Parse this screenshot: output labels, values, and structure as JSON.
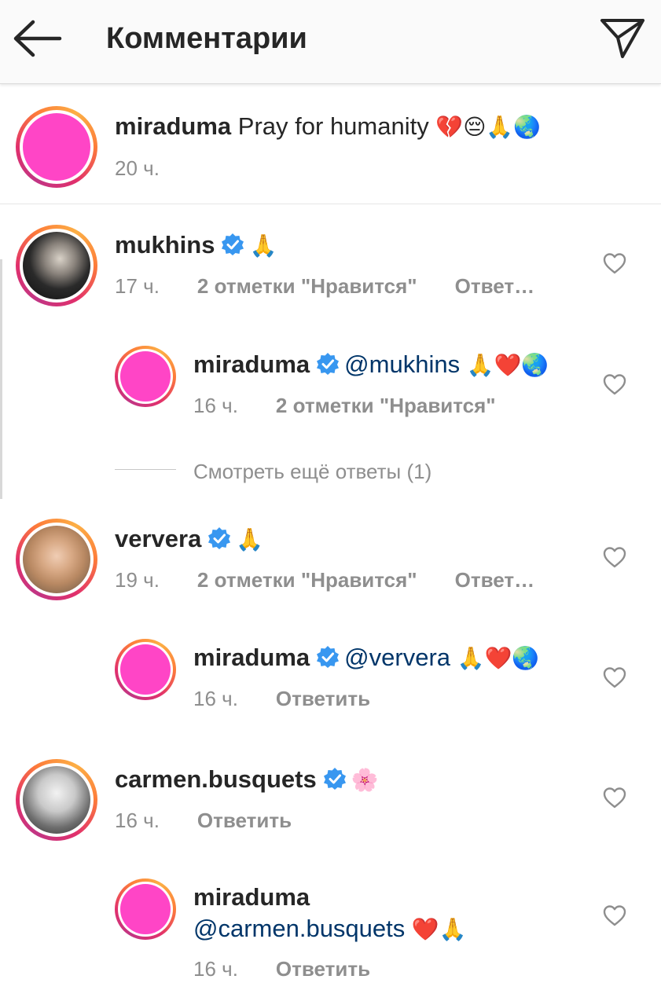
{
  "header": {
    "title": "Комментарии",
    "back_icon": "arrow-left-icon",
    "share_icon": "paper-plane-icon"
  },
  "colors": {
    "avatar_fill": "#ff45c6",
    "mention": "#003569",
    "verified": "#3897f0",
    "muted": "#8e8e8e"
  },
  "caption": {
    "username": "miraduma",
    "text": "Pray for humanity",
    "emoji": "💔😔🙏🌏",
    "time": "20 ч."
  },
  "comments": [
    {
      "username": "mukhins",
      "verified": true,
      "text": "🙏",
      "time": "17 ч.",
      "likes": "2 отметки \"Нравится\"",
      "reply": "Ответ…"
    },
    {
      "username": "miraduma",
      "verified": true,
      "mention": "@mukhins",
      "text": "🙏❤️🌏",
      "time": "16 ч.",
      "likes": "2 отметки \"Нравится\""
    },
    {
      "username": "ververa",
      "verified": true,
      "text": "🙏",
      "time": "19 ч.",
      "likes": "2 отметки \"Нравится\"",
      "reply": "Ответ…"
    },
    {
      "username": "miraduma",
      "verified": true,
      "mention": "@ververa",
      "text": "🙏❤️🌏",
      "time": "16 ч.",
      "reply": "Ответить"
    },
    {
      "username": "carmen.busquets",
      "verified": true,
      "text": "🌸",
      "time": "16 ч.",
      "reply": "Ответить"
    },
    {
      "username": "miraduma",
      "verified": false,
      "mention": "@carmen.busquets",
      "text": "❤️🙏",
      "time": "16 ч.",
      "reply": "Ответить"
    }
  ],
  "view_more": "Смотреть ещё ответы (1)"
}
